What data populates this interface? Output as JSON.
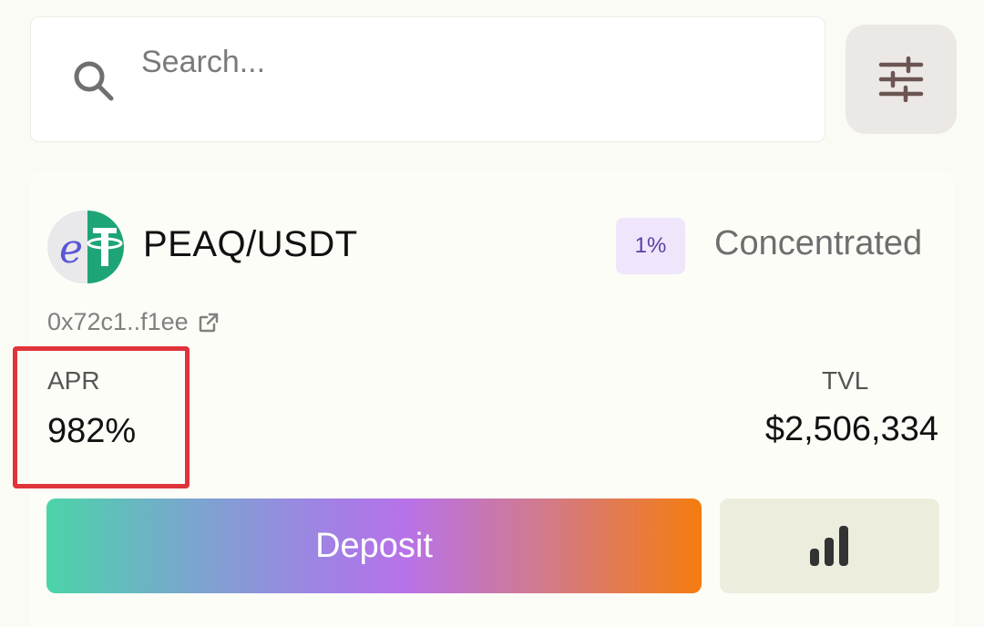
{
  "search": {
    "placeholder": "Search..."
  },
  "pool": {
    "pair": "PEAQ/USDT",
    "fee": "1%",
    "type": "Concentrated",
    "address": "0x72c1..f1ee",
    "apr_label": "APR",
    "apr_value": "982%",
    "tvl_label": "TVL",
    "tvl_value": "$2,506,334"
  },
  "actions": {
    "deposit_label": "Deposit"
  },
  "icons": {
    "search": "search-icon",
    "filter": "sliders-icon",
    "external_link": "external-link-icon",
    "stats": "bar-chart-icon"
  },
  "colors": {
    "highlight": "#e0343a",
    "fee_badge_bg": "#efe6fb",
    "deposit_gradient_start": "#4bd4a8",
    "deposit_gradient_end": "#f57c0f"
  }
}
